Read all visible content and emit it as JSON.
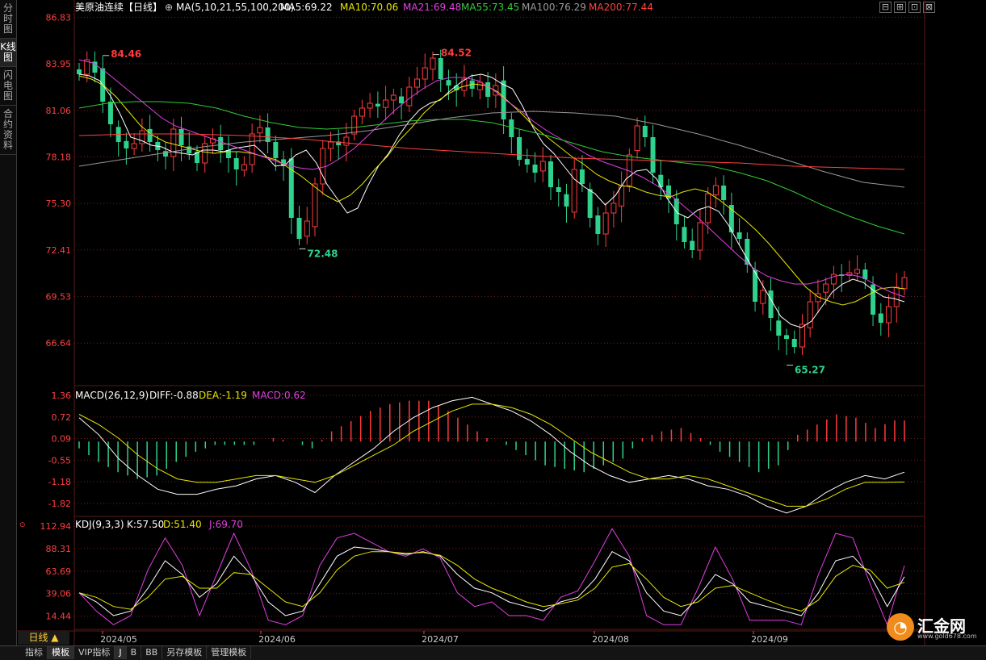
{
  "sidebar": [
    {
      "label": "分时图",
      "active": false
    },
    {
      "label": "K线图",
      "active": true
    },
    {
      "label": "闪电图",
      "active": false
    },
    {
      "label": "合约资料",
      "active": false
    }
  ],
  "header": {
    "symbol": "美原油连续【日线】",
    "ma_params": "MA(5,10,21,55,100,200)",
    "ma_values": [
      {
        "label": "MA5:69.22",
        "color": "#ffffff"
      },
      {
        "label": "MA10:70.06",
        "color": "#e6e600"
      },
      {
        "label": "MA21:69.48",
        "color": "#e040e0"
      },
      {
        "label": "MA55:73.45",
        "color": "#33cc33"
      },
      {
        "label": "MA100:76.29",
        "color": "#999999"
      },
      {
        "label": "MA200:77.44",
        "color": "#ff4040"
      }
    ]
  },
  "macd_header": {
    "label": "MACD(26,12,9)",
    "diff": "DIFF:-0.88",
    "dea": "DEA:-1.19",
    "macd": "MACD:0.62"
  },
  "kdj_header": {
    "label": "KDJ(9,3,3)",
    "k": "K:57.50",
    "d": "D:51.40",
    "j": "J:69.70"
  },
  "period_badge": "日线 ▲",
  "bottom_tabs": [
    {
      "label": "指标",
      "selected": false
    },
    {
      "label": "模板",
      "selected": true
    },
    {
      "label": "VIP指标",
      "selected": false
    },
    {
      "label": "J",
      "selected": true
    },
    {
      "label": "B",
      "selected": false
    },
    {
      "label": "BB",
      "selected": false
    },
    {
      "label": "另存模板",
      "selected": false
    },
    {
      "label": "管理模板",
      "selected": false
    }
  ],
  "logo": {
    "mark": "◔",
    "name": "汇金网",
    "url": "www.gold678.com"
  },
  "colors": {
    "up": "#ff3b3b",
    "down": "#2fd28c",
    "axis": "#ff4040",
    "grid": "#7a1f1f"
  },
  "chart_data": [
    {
      "type": "candlestick",
      "title": "美原油连续【日线】",
      "y_axis_ticks": [
        "86.83",
        "83.95",
        "81.06",
        "78.18",
        "75.30",
        "72.41",
        "69.53",
        "66.64"
      ],
      "ylim": [
        64.0,
        87.5
      ],
      "x_labels": [
        "2024/05",
        "2024/06",
        "2024/07",
        "2024/08",
        "2024/09"
      ],
      "annotations": [
        {
          "label": "84.46",
          "type": "high"
        },
        {
          "label": "72.48",
          "type": "low"
        },
        {
          "label": "84.52",
          "type": "high"
        },
        {
          "label": "65.27",
          "type": "low"
        }
      ],
      "ohlc_approx_start": 83.6,
      "closes_approx": [
        83.3,
        84.2,
        83.4,
        81.6,
        80.2,
        79.1,
        78.7,
        79.0,
        79.8,
        79.1,
        78.6,
        78.2,
        79.9,
        78.9,
        78.4,
        77.8,
        79.0,
        79.3,
        78.6,
        78.1,
        77.4,
        77.7,
        79.6,
        80.0,
        79.1,
        78.1,
        77.6,
        74.4,
        73.1,
        74.2,
        76.5,
        78.7,
        79.1,
        78.9,
        79.4,
        80.7,
        81.2,
        81.5,
        81.3,
        81.7,
        82.0,
        81.5,
        82.5,
        83.0,
        83.7,
        84.3,
        83.0,
        82.6,
        82.3,
        83.0,
        82.4,
        82.8,
        81.9,
        82.6,
        80.5,
        79.4,
        78.0,
        77.7,
        77.2,
        77.9,
        76.3,
        76.0,
        75.1,
        77.4,
        76.5,
        74.4,
        73.4,
        74.7,
        75.3,
        76.4,
        78.3,
        80.1,
        79.4,
        77.2,
        76.3,
        75.6,
        74.0,
        72.9,
        72.4,
        74.1,
        75.9,
        76.4,
        75.5,
        73.5,
        73.1,
        71.5,
        69.2,
        69.9,
        68.2,
        67.1,
        66.9,
        66.4,
        67.8,
        69.2,
        69.7,
        70.3,
        70.9,
        70.8,
        71.0,
        71.2,
        70.6,
        68.4,
        67.9,
        68.9,
        70.1,
        70.7
      ],
      "series": [
        {
          "name": "MA5",
          "values_approx": [
            83.3,
            83.2,
            82.9,
            82.0,
            80.8,
            79.4,
            79.2,
            78.9,
            78.8,
            78.5,
            78.4,
            78.3,
            78.6,
            78.6,
            78.5,
            78.7,
            78.8,
            78.9,
            78.3,
            77.6,
            77.7,
            78.3,
            78.6,
            77.8,
            76.5,
            75.6,
            74.7,
            75.0,
            76.4,
            77.6,
            78.4,
            79.5,
            80.4,
            81.1,
            81.5,
            81.7,
            82.3,
            82.8,
            83.2,
            83.3,
            83.1,
            82.7,
            82.4,
            81.3,
            80.0,
            79.0,
            78.4,
            77.6,
            76.8,
            76.3,
            75.9,
            75.2,
            75.8,
            76.8,
            77.3,
            77.4,
            76.8,
            75.6,
            74.7,
            74.4,
            74.9,
            75.1,
            74.8,
            73.9,
            72.7,
            71.6,
            70.5,
            69.4,
            68.3,
            67.8,
            67.6,
            68.0,
            68.9,
            69.8,
            70.3,
            70.6,
            70.4,
            69.9,
            69.5,
            69.4,
            69.2
          ]
        },
        {
          "name": "MA10",
          "values_approx": [
            83.2,
            83.0,
            82.6,
            81.9,
            81.0,
            80.1,
            79.5,
            79.1,
            78.9,
            78.7,
            78.5,
            78.4,
            78.5,
            78.5,
            78.4,
            78.2,
            78.0,
            77.5,
            77.0,
            76.4,
            75.8,
            75.4,
            75.8,
            76.5,
            77.4,
            78.2,
            79.2,
            80.0,
            80.9,
            81.6,
            82.1,
            82.5,
            82.7,
            82.6,
            82.2,
            81.5,
            80.8,
            80.0,
            79.4,
            78.8,
            78.2,
            77.7,
            77.1,
            76.7,
            76.4,
            76.3,
            76.0,
            75.8,
            75.7,
            76.0,
            76.2,
            76.0,
            75.5,
            74.9,
            74.3,
            73.6,
            72.8,
            71.9,
            71.0,
            70.1,
            69.5,
            69.2,
            69.0,
            69.2,
            69.6,
            70.0,
            70.1,
            70.0
          ]
        },
        {
          "name": "MA21",
          "values_approx": [
            84.2,
            84.0,
            83.4,
            82.7,
            82.0,
            81.3,
            80.6,
            80.1,
            79.8,
            79.5,
            79.2,
            78.9,
            78.6,
            78.3,
            78.0,
            77.7,
            77.5,
            77.4,
            77.6,
            78.1,
            78.7,
            79.5,
            80.3,
            81.1,
            81.8,
            82.4,
            82.9,
            83.1,
            83.1,
            82.9,
            82.4,
            81.7,
            81.1,
            80.4,
            79.8,
            79.3,
            78.8,
            78.3,
            77.9,
            77.6,
            77.3,
            76.9,
            76.4,
            75.8,
            75.1,
            74.4,
            73.6,
            72.8,
            72.0,
            71.3,
            70.8,
            70.5,
            70.3,
            70.3,
            70.5,
            70.8,
            70.9,
            70.7,
            70.2,
            69.8,
            69.5
          ]
        },
        {
          "name": "MA55",
          "values_approx": [
            81.2,
            81.5,
            81.6,
            81.6,
            81.5,
            81.2,
            80.7,
            80.3,
            80.0,
            79.9,
            80.0,
            80.2,
            80.4,
            80.5,
            80.5,
            80.3,
            79.9,
            79.5,
            79.0,
            78.5,
            78.2,
            78.0,
            77.8,
            77.6,
            77.2,
            76.7,
            76.0,
            75.2,
            74.5,
            73.9,
            73.4
          ]
        },
        {
          "name": "MA100",
          "values_approx": [
            77.6,
            78.0,
            78.4,
            78.8,
            79.1,
            79.3,
            79.5,
            79.8,
            80.2,
            80.6,
            80.9,
            81.0,
            80.9,
            80.7,
            80.2,
            79.6,
            78.9,
            78.1,
            77.3,
            76.6,
            76.3
          ]
        },
        {
          "name": "MA200",
          "values_approx": [
            79.5,
            79.6,
            79.6,
            79.5,
            79.3,
            79.0,
            78.7,
            78.5,
            78.3,
            78.1,
            78.0,
            77.9,
            77.8,
            77.6,
            77.5,
            77.4
          ]
        }
      ]
    },
    {
      "type": "macd",
      "title": "MACD(26,12,9)",
      "y_axis_ticks": [
        "1.36",
        "0.72",
        "0.09",
        "-0.55",
        "-1.18",
        "-1.82"
      ],
      "ylim": [
        -2.2,
        1.5
      ],
      "series": [
        {
          "name": "DIFF",
          "values_approx": [
            0.7,
            0.2,
            -0.5,
            -1.0,
            -1.4,
            -1.55,
            -1.55,
            -1.4,
            -1.3,
            -1.1,
            -1.0,
            -1.2,
            -1.5,
            -1.0,
            -0.6,
            -0.2,
            0.3,
            0.7,
            1.0,
            1.2,
            1.3,
            1.1,
            0.9,
            0.6,
            0.2,
            -0.3,
            -0.7,
            -1.0,
            -1.2,
            -1.1,
            -1.0,
            -1.1,
            -1.3,
            -1.4,
            -1.6,
            -1.9,
            -2.1,
            -1.9,
            -1.5,
            -1.2,
            -1.0,
            -1.1,
            -0.9
          ]
        },
        {
          "name": "DEA",
          "values_approx": [
            0.8,
            0.5,
            0.1,
            -0.4,
            -0.8,
            -1.1,
            -1.2,
            -1.2,
            -1.1,
            -1.0,
            -1.0,
            -1.1,
            -1.2,
            -1.0,
            -0.7,
            -0.4,
            -0.1,
            0.3,
            0.6,
            0.9,
            1.1,
            1.1,
            1.0,
            0.8,
            0.5,
            0.1,
            -0.3,
            -0.6,
            -0.9,
            -1.1,
            -1.1,
            -1.0,
            -1.1,
            -1.3,
            -1.5,
            -1.7,
            -1.9,
            -1.9,
            -1.7,
            -1.4,
            -1.2,
            -1.2,
            -1.19
          ]
        },
        {
          "name": "MACD",
          "values_approx": [
            -0.2,
            -0.6,
            -0.9,
            -1.1,
            -1.0,
            -0.6,
            -0.3,
            -0.1,
            -0.1,
            -0.1,
            0.1,
            0.0,
            -0.2,
            0.3,
            0.6,
            0.9,
            1.1,
            1.2,
            1.2,
            0.9,
            0.5,
            0.1,
            -0.1,
            -0.4,
            -0.7,
            -0.8,
            -0.9,
            -0.7,
            -0.5,
            0.1,
            0.3,
            0.4,
            0.1,
            -0.3,
            -0.6,
            -0.9,
            -0.7,
            0.2,
            0.5,
            0.8,
            0.7,
            0.4,
            0.62
          ]
        }
      ]
    },
    {
      "type": "kdj",
      "title": "KDJ(9,3,3)",
      "y_axis_ticks": [
        "112.94",
        "88.31",
        "63.69",
        "39.06",
        "14.44"
      ],
      "ylim": [
        0,
        120
      ],
      "series": [
        {
          "name": "K",
          "values_approx": [
            40,
            30,
            15,
            20,
            45,
            75,
            60,
            35,
            50,
            80,
            60,
            30,
            15,
            20,
            50,
            80,
            90,
            88,
            85,
            82,
            85,
            80,
            60,
            45,
            40,
            30,
            25,
            20,
            30,
            35,
            55,
            85,
            75,
            40,
            20,
            15,
            35,
            60,
            50,
            30,
            25,
            20,
            15,
            40,
            75,
            80,
            60,
            25,
            57.5
          ]
        },
        {
          "name": "D",
          "values_approx": [
            40,
            35,
            25,
            22,
            35,
            55,
            58,
            45,
            45,
            62,
            60,
            45,
            30,
            25,
            40,
            65,
            80,
            85,
            85,
            83,
            84,
            81,
            70,
            55,
            45,
            38,
            30,
            25,
            28,
            32,
            45,
            68,
            72,
            55,
            35,
            25,
            30,
            45,
            48,
            40,
            32,
            25,
            20,
            32,
            58,
            70,
            65,
            45,
            51.4
          ]
        },
        {
          "name": "J",
          "values_approx": [
            40,
            20,
            5,
            15,
            65,
            100,
            70,
            15,
            60,
            105,
            65,
            10,
            5,
            15,
            70,
            100,
            105,
            95,
            85,
            80,
            88,
            78,
            40,
            25,
            30,
            15,
            15,
            10,
            35,
            42,
            75,
            110,
            80,
            15,
            5,
            5,
            45,
            90,
            55,
            10,
            10,
            10,
            5,
            60,
            105,
            100,
            50,
            5,
            69.7
          ]
        }
      ],
      "x_labels": [
        "2024/05",
        "2024/06",
        "2024/07",
        "2024/08",
        "2024/09"
      ]
    }
  ]
}
